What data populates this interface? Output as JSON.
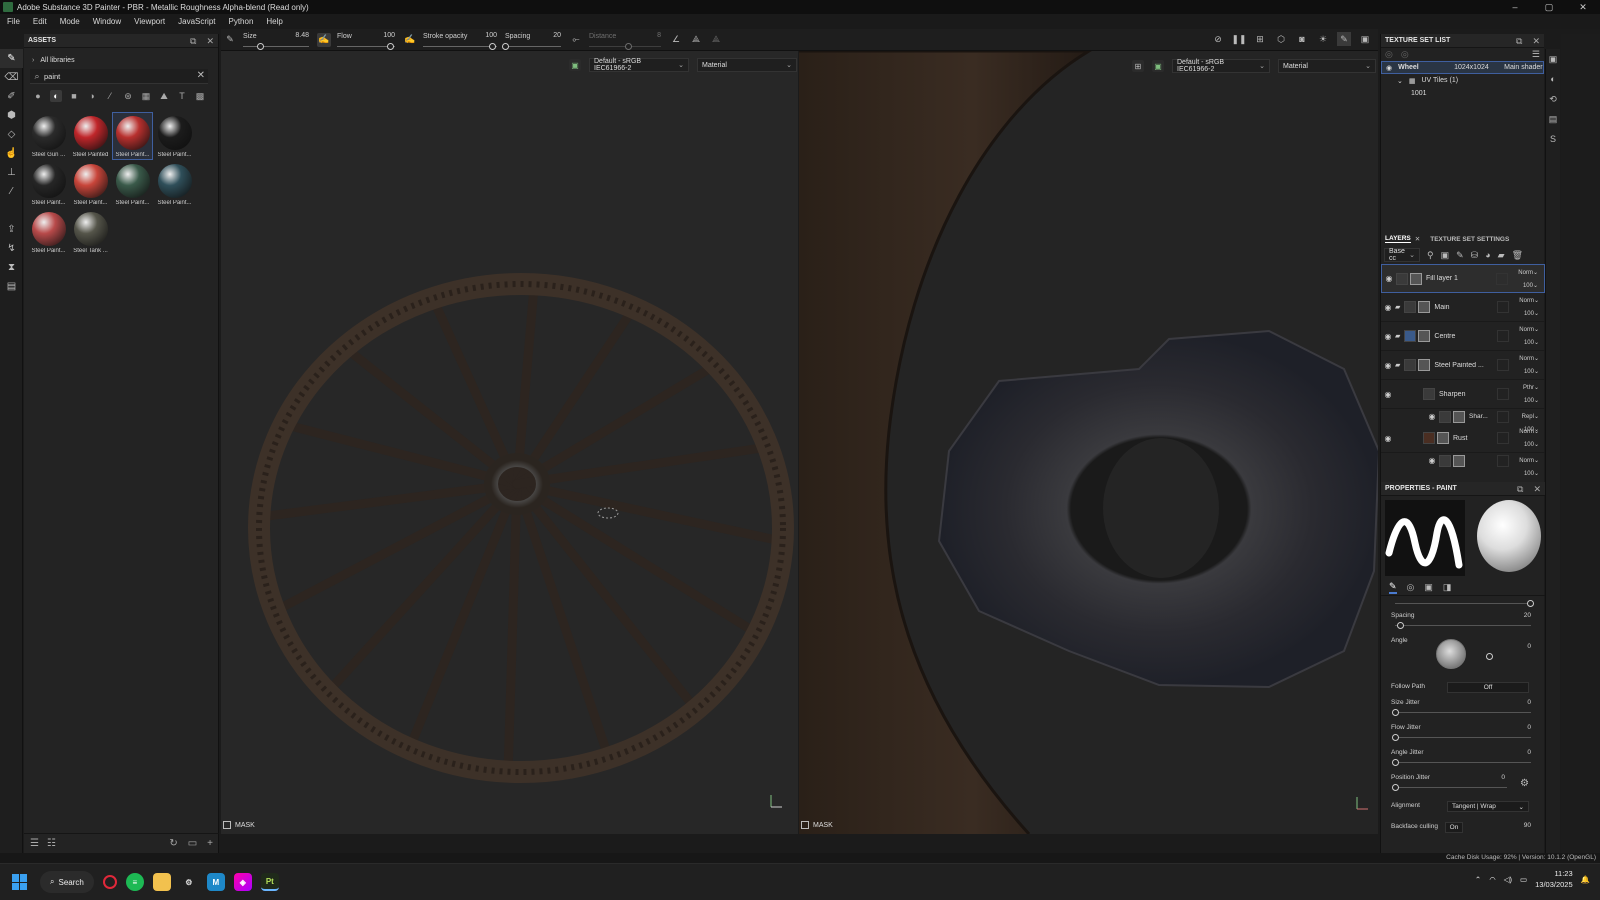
{
  "window": {
    "title": "Adobe Substance 3D Painter - PBR - Metallic Roughness Alpha-blend (Read only)",
    "controls": [
      "–",
      "▢",
      "✕"
    ]
  },
  "menu": [
    "File",
    "Edit",
    "Mode",
    "Window",
    "Viewport",
    "JavaScript",
    "Python",
    "Help"
  ],
  "assets": {
    "title": "ASSETS",
    "library": "All libraries",
    "search_value": "paint",
    "items": [
      {
        "label": "Steel Gun ...",
        "color": "#2b2b2b"
      },
      {
        "label": "Steel Painted",
        "color": "#c0262a"
      },
      {
        "label": "Steel Paint...",
        "color": "#b8302e"
      },
      {
        "label": "Steel Paint...",
        "color": "#1c1c1c"
      },
      {
        "label": "Steel Paint...",
        "color": "#262626"
      },
      {
        "label": "Steel Paint...",
        "color": "#c8453a"
      },
      {
        "label": "Steel Paint...",
        "color": "#3a5a4a"
      },
      {
        "label": "Steel Paint...",
        "color": "#2f4f5a"
      },
      {
        "label": "Steel Paint...",
        "color": "#b84a4a"
      },
      {
        "label": "Steel Tank ...",
        "color": "#55554a"
      }
    ]
  },
  "toolbar": {
    "size_label": "Size",
    "size_value": "8.48",
    "flow_label": "Flow",
    "flow_value": "100",
    "stroke_opacity_label": "Stroke opacity",
    "stroke_opacity_value": "100",
    "spacing_label": "Spacing",
    "spacing_value": "20",
    "distance_label": "Distance",
    "distance_value": "8"
  },
  "viewport3d": {
    "colorspace": "Default - sRGB IEC61966-2",
    "channel": "Material",
    "mask_label": "MASK"
  },
  "viewport2d": {
    "colorspace": "Default - sRGB IEC61966-2",
    "channel": "Material",
    "mask_label": "MASK"
  },
  "texture_set_list": {
    "title": "TEXTURE SET LIST",
    "set_name": "Wheel",
    "resolution": "1024x1024",
    "shader": "Main shader",
    "uv_tiles": "UV Tiles (1)",
    "tile": "1001"
  },
  "layers_panel": {
    "tab_layers": "LAYERS",
    "tab_settings": "TEXTURE SET SETTINGS",
    "channel": "Base cc",
    "layers": [
      {
        "name": "Fill layer 1",
        "blend": "Norm",
        "opacity": "100"
      },
      {
        "name": "Main",
        "blend": "Norm",
        "opacity": "100"
      },
      {
        "name": "Centre",
        "blend": "Norm",
        "opacity": "100"
      },
      {
        "name": "Steel Painted ...",
        "blend": "Norm",
        "opacity": "100"
      },
      {
        "name": "Sharpen",
        "blend": "Pthr",
        "opacity": "100"
      },
      {
        "name": "Shar...",
        "blend": "Repl",
        "opacity": "100"
      },
      {
        "name": "Rust",
        "blend": "Norm",
        "opacity": "100"
      },
      {
        "name": "",
        "blend": "Norm",
        "opacity": "100"
      }
    ]
  },
  "properties": {
    "title": "PROPERTIES - PAINT",
    "spacing_label": "Spacing",
    "spacing_value": "20",
    "angle_label": "Angle",
    "angle_value": "0",
    "follow_path_label": "Follow Path",
    "follow_path_value": "Off",
    "size_jitter_label": "Size Jitter",
    "size_jitter_value": "0",
    "flow_jitter_label": "Flow Jitter",
    "flow_jitter_value": "0",
    "angle_jitter_label": "Angle Jitter",
    "angle_jitter_value": "0",
    "position_jitter_label": "Position Jitter",
    "position_jitter_value": "0",
    "alignment_label": "Alignment",
    "alignment_value": "Tangent | Wrap",
    "backface_label": "Backface culling",
    "backface_value": "On",
    "backface_num": "90"
  },
  "status": {
    "text": "Cache Disk Usage:  92% | Version: 10.1.2 (OpenGL)"
  },
  "taskbar": {
    "search_label": "Search",
    "time": "11:23",
    "date": "13/03/2025"
  }
}
